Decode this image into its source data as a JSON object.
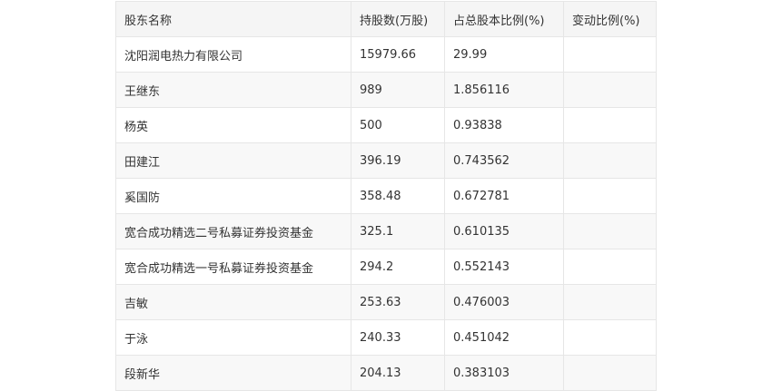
{
  "table": {
    "headers": [
      "股东名称",
      "持股数(万股)",
      "占总股本比例(%)",
      "变动比例(%)"
    ],
    "rows": [
      [
        "沈阳润电热力有限公司",
        "15979.66",
        "29.99",
        ""
      ],
      [
        "王继东",
        "989",
        "1.856116",
        ""
      ],
      [
        "杨英",
        "500",
        "0.93838",
        ""
      ],
      [
        "田建江",
        "396.19",
        "0.743562",
        ""
      ],
      [
        "奚国防",
        "358.48",
        "0.672781",
        ""
      ],
      [
        "宽合成功精选二号私募证券投资基金",
        "325.1",
        "0.610135",
        ""
      ],
      [
        "宽合成功精选一号私募证券投资基金",
        "294.2",
        "0.552143",
        ""
      ],
      [
        "吉敏",
        "253.63",
        "0.476003",
        ""
      ],
      [
        "于泳",
        "240.33",
        "0.451042",
        ""
      ],
      [
        "段新华",
        "204.13",
        "0.383103",
        ""
      ]
    ]
  }
}
